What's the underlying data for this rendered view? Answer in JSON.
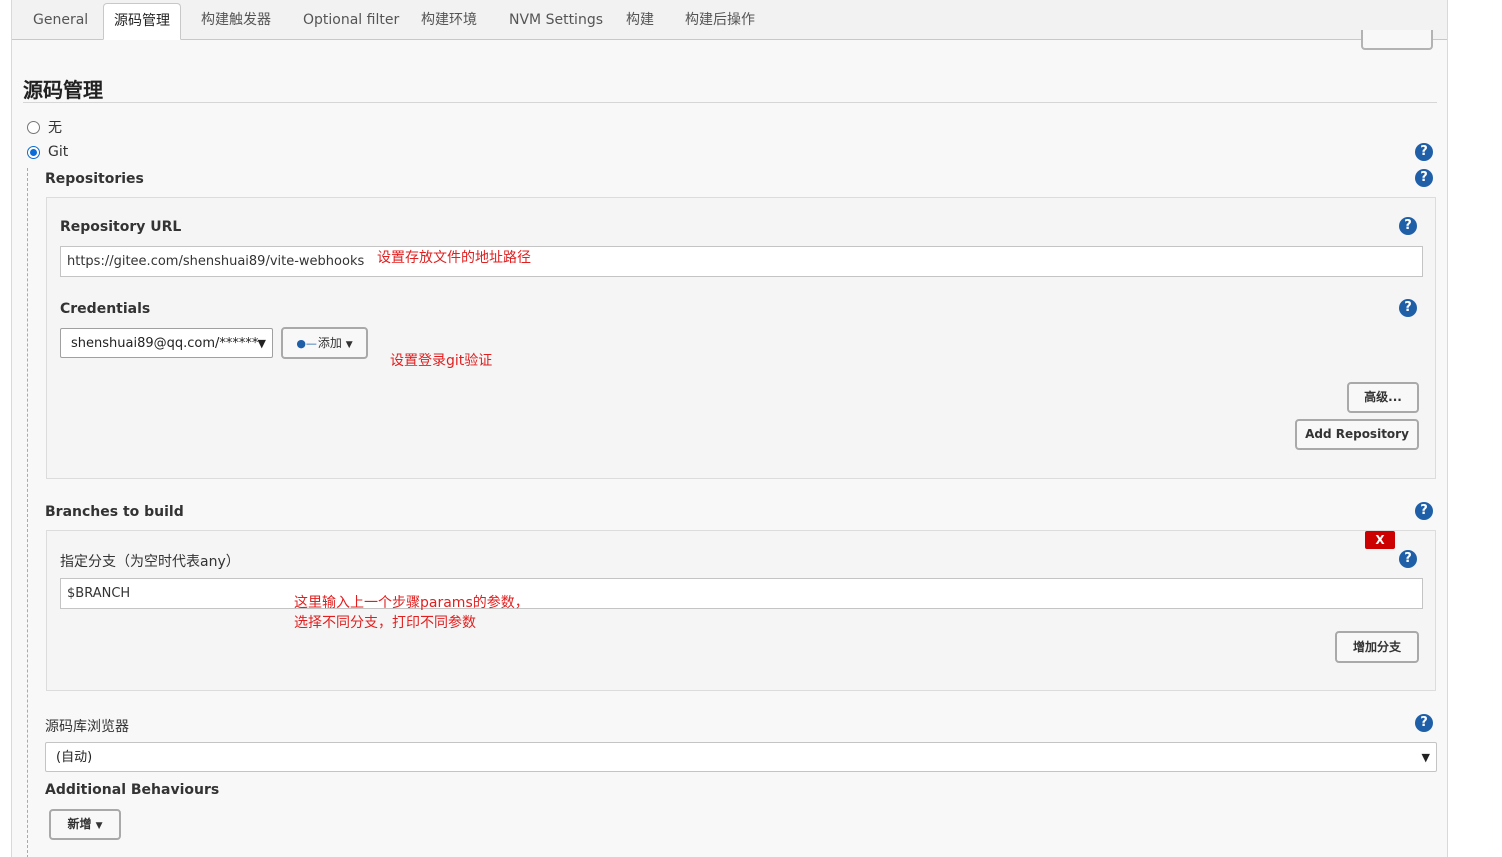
{
  "tabs": [
    {
      "label": "General"
    },
    {
      "label": "源码管理"
    },
    {
      "label": "构建触发器"
    },
    {
      "label": "Optional filter"
    },
    {
      "label": "构建环境"
    },
    {
      "label": "NVM Settings"
    },
    {
      "label": "构建"
    },
    {
      "label": "构建后操作"
    }
  ],
  "active_tab": "源码管理",
  "section": {
    "title": "源码管理"
  },
  "scm": {
    "options": [
      {
        "label": "无",
        "checked": false
      },
      {
        "label": "Git",
        "checked": true
      }
    ]
  },
  "repositories": {
    "label": "Repositories",
    "url_label": "Repository URL",
    "url_value": "https://gitee.com/shenshuai89/vite-webhooks",
    "credentials_label": "Credentials",
    "credentials_value": "shenshuai89@qq.com/******",
    "add_button": "添加",
    "advanced_button": "高级...",
    "add_repository_button": "Add Repository"
  },
  "branches": {
    "label": "Branches to build",
    "spec_label": "指定分支（为空时代表any）",
    "spec_value": "$BRANCH",
    "delete_button": "X",
    "add_branch_button": "增加分支"
  },
  "browser": {
    "label": "源码库浏览器",
    "value": "(自动)"
  },
  "behaviours": {
    "label": "Additional Behaviours",
    "add_button": "新增"
  },
  "annotations": {
    "url_note": "设置存放文件的地址路径",
    "credentials_note": "设置登录git验证",
    "branch_note_line1": "这里输入上一个步骤params的参数，",
    "branch_note_line2": "选择不同分支，打印不同参数"
  },
  "icons": {
    "help": "help-icon",
    "key": "key-icon",
    "caret": "caret-down-icon"
  },
  "colors": {
    "accent": "#1f5fa8",
    "annotation": "#e02020",
    "delete": "#cc0000"
  }
}
